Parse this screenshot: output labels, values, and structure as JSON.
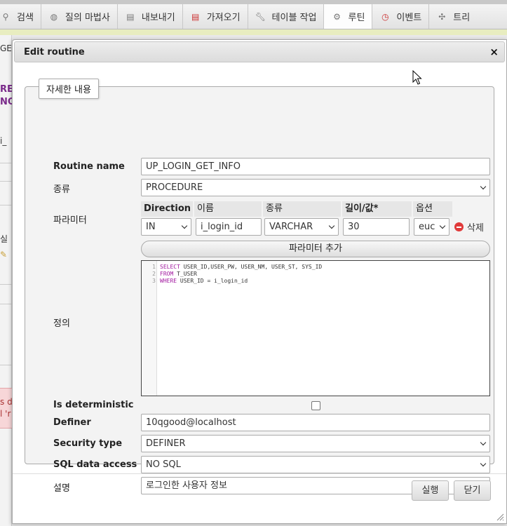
{
  "tabs": [
    {
      "label": "검색",
      "icon": "search-icon"
    },
    {
      "label": "질의 마법사",
      "icon": "database-icon"
    },
    {
      "label": "내보내기",
      "icon": "export-icon"
    },
    {
      "label": "가져오기",
      "icon": "import-icon"
    },
    {
      "label": "테이블 작업",
      "icon": "wrench-icon"
    },
    {
      "label": "루틴",
      "icon": "routines-icon"
    },
    {
      "label": "이벤트",
      "icon": "clock-icon"
    },
    {
      "label": "트리",
      "icon": "trigger-icon"
    }
  ],
  "background": {
    "fragments": [
      "GE",
      "RE",
      "NO",
      "i_",
      "실",
      "s d",
      "l 'r"
    ]
  },
  "dialog": {
    "title": "Edit routine",
    "close_glyph": "×",
    "legend": "자세한 내용",
    "routine_name": {
      "label": "Routine name",
      "value": "UP_LOGIN_GET_INFO"
    },
    "type": {
      "label": "종류",
      "value": "PROCEDURE"
    },
    "params": {
      "label": "파라미터",
      "headers": [
        "Direction",
        "이름",
        "종류",
        "길이/값*",
        "옵션"
      ],
      "row": {
        "direction": "IN",
        "name": "i_login_id",
        "type": "VARCHAR",
        "length": "30",
        "option": "euc"
      },
      "delete_label": "삭제",
      "add_label": "파라미터 추가"
    },
    "definition": {
      "label": "정의",
      "lines": [
        {
          "num": "1",
          "kw": "SELECT",
          "rest": " USER_ID,USER_PW, USER_NM, USER_ST, SYS_ID"
        },
        {
          "num": "2",
          "kw": "FROM",
          "rest": " T_USER"
        },
        {
          "num": "3",
          "kw": "WHERE",
          "rest": " USER_ID = i_login_id"
        }
      ]
    },
    "deterministic": {
      "label": "Is deterministic",
      "checked": false
    },
    "definer": {
      "label": "Definer",
      "value": "10qgood@localhost"
    },
    "security_type": {
      "label": "Security type",
      "value": "DEFINER"
    },
    "sql_data_access": {
      "label": "SQL data access",
      "value": "NO SQL"
    },
    "comment": {
      "label": "설명",
      "value": "로그인한 사용자 정보"
    },
    "buttons": {
      "go": "실행",
      "close": "닫기"
    }
  }
}
